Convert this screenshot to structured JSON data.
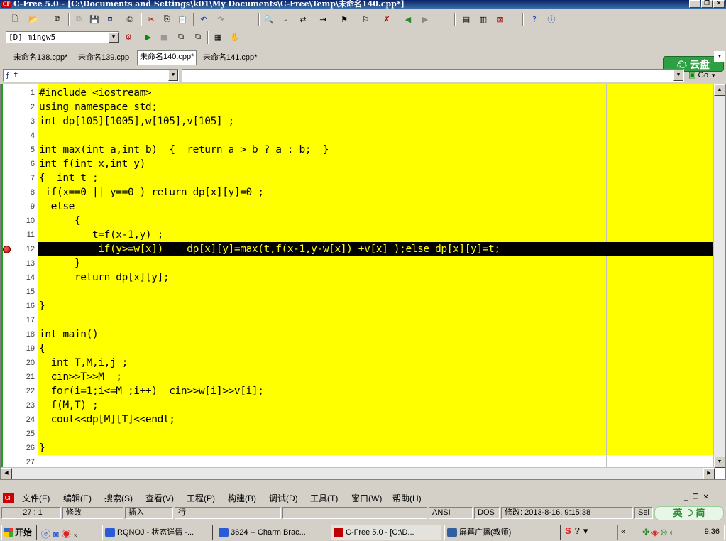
{
  "window": {
    "title": "C-Free 5.0 - [C:\\Documents and Settings\\k01\\My Documents\\C-Free\\Temp\\未命名140.cpp*]",
    "controls": [
      "_",
      "❐",
      "✕"
    ]
  },
  "toolbar": {
    "compiler_select": "[D] mingw5",
    "cloud_button": "云盘"
  },
  "tabs": [
    {
      "label": "未命名138.cpp*",
      "active": false
    },
    {
      "label": "未命名139.cpp",
      "active": false
    },
    {
      "label": "未命名140.cpp*",
      "active": true
    },
    {
      "label": "未命名141.cpp*",
      "active": false
    }
  ],
  "function_bar": {
    "selector_value": "f",
    "go_label": "Go"
  },
  "editor": {
    "highlight_color": "#ffff00",
    "breakpoint_line": 12,
    "lines": [
      {
        "n": "1",
        "code": "#include <iostream>"
      },
      {
        "n": "2",
        "code": "using namespace std;"
      },
      {
        "n": "3",
        "code": "int dp[105][1005],w[105],v[105] ;"
      },
      {
        "n": "4",
        "code": ""
      },
      {
        "n": "5",
        "code": "int max(int a,int b)  {  return a > b ? a : b;  }"
      },
      {
        "n": "6",
        "code": "int f(int x,int y)"
      },
      {
        "n": "7",
        "code": "{  int t ;"
      },
      {
        "n": "8",
        "code": " if(x==0 || y==0 ) return dp[x][y]=0 ;"
      },
      {
        "n": "9",
        "code": "  else"
      },
      {
        "n": "10",
        "code": "      {"
      },
      {
        "n": "11",
        "code": "         t=f(x-1,y) ;"
      },
      {
        "n": "12",
        "code": "          if(y>=w[x])    dp[x][y]=max(t,f(x-1,y-w[x]) +v[x] );else dp[x][y]=t;"
      },
      {
        "n": "13",
        "code": "      }"
      },
      {
        "n": "14",
        "code": "      return dp[x][y];"
      },
      {
        "n": "15",
        "code": ""
      },
      {
        "n": "16",
        "code": "}"
      },
      {
        "n": "17",
        "code": ""
      },
      {
        "n": "18",
        "code": "int main()"
      },
      {
        "n": "19",
        "code": "{"
      },
      {
        "n": "20",
        "code": "  int T,M,i,j ;"
      },
      {
        "n": "21",
        "code": "  cin>>T>>M  ;"
      },
      {
        "n": "22",
        "code": "  for(i=1;i<=M ;i++)  cin>>w[i]>>v[i];"
      },
      {
        "n": "23",
        "code": "  f(M,T) ;"
      },
      {
        "n": "24",
        "code": "  cout<<dp[M][T]<<endl;"
      },
      {
        "n": "25",
        "code": ""
      },
      {
        "n": "26",
        "code": "}"
      },
      {
        "n": "27",
        "code": ""
      }
    ]
  },
  "menubar": {
    "items": [
      "文件(F)",
      "编辑(E)",
      "搜索(S)",
      "查看(V)",
      "工程(P)",
      "构建(B)",
      "调试(D)",
      "工具(T)",
      "窗口(W)",
      "帮助(H)"
    ]
  },
  "statusbar": {
    "position": "27 :  1",
    "modified": "修改",
    "insert": "插入",
    "line_mode": "行",
    "encoding": "ANSI",
    "line_ending": "DOS",
    "modified_time": "修改: 2013-8-16, 9:15:38",
    "sel": "Sel",
    "ime": "英 ☽ 简"
  },
  "taskbar": {
    "start_label": "开始",
    "tasks": [
      {
        "label": "RQNOJ - 状态详情 -...",
        "active": false,
        "color": "#2a5bd7"
      },
      {
        "label": "3624 -- Charm Brac...",
        "active": false,
        "color": "#2a5bd7"
      },
      {
        "label": "C-Free 5.0 - [C:\\D...",
        "active": true,
        "color": "#c00000"
      },
      {
        "label": "屏幕广播(教师)",
        "active": false,
        "color": "#3060a0"
      }
    ],
    "clock": "9:36"
  }
}
